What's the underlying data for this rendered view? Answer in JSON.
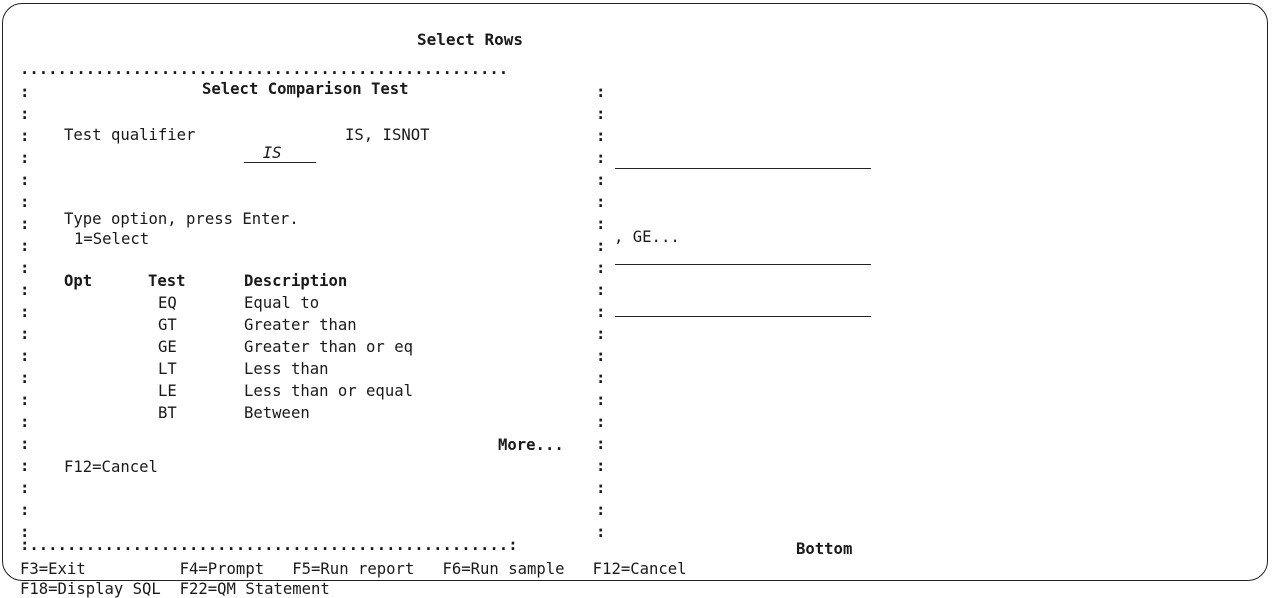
{
  "screen": {
    "title": "Select Rows",
    "bottom_indicator": "Bottom",
    "right_fragment": ", GE...",
    "function_keys_line1": "F3=Exit          F4=Prompt   F5=Run report   F6=Run sample   F12=Cancel",
    "function_keys_line2": "F18=Display SQL  F22=QM Statement"
  },
  "popup": {
    "title": "Select Comparison Test",
    "qualifier_label": "Test qualifier",
    "qualifier_value": "IS",
    "qualifier_options": "IS, ISNOT",
    "instruction": "Type option, press Enter.",
    "option_hint": "1=Select",
    "columns": {
      "opt": "Opt",
      "test": "Test",
      "description": "Description"
    },
    "rows": [
      {
        "test": "EQ",
        "description": "Equal to"
      },
      {
        "test": "GT",
        "description": "Greater than"
      },
      {
        "test": "GE",
        "description": "Greater than or eq"
      },
      {
        "test": "LT",
        "description": "Less than"
      },
      {
        "test": "LE",
        "description": "Less than or equal"
      },
      {
        "test": "BT",
        "description": "Between"
      }
    ],
    "more_indicator": "More...",
    "footer_key": "F12=Cancel"
  }
}
